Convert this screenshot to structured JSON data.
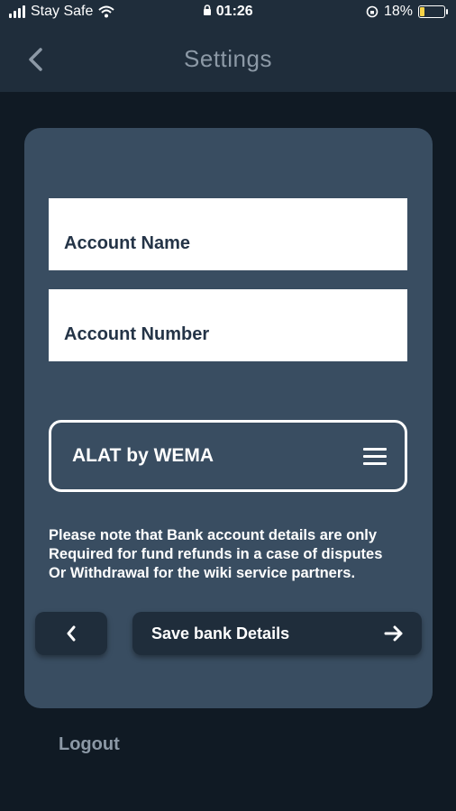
{
  "status_bar": {
    "carrier": "Stay Safe",
    "time": "01:26",
    "battery": "18%"
  },
  "nav": {
    "title": "Settings"
  },
  "form": {
    "account_name_placeholder": "Account Name",
    "account_number_placeholder": "Account Number",
    "bank_selected": "ALAT by WEMA",
    "note_lines": [
      "Please note that Bank account details are only",
      "Required for fund refunds in a case of disputes",
      "Or Withdrawal for the wiki service partners."
    ],
    "save_label": "Save bank Details"
  },
  "footer": {
    "logout_label": "Logout"
  },
  "colors": {
    "background": "#101a24",
    "bar": "#1f2d3b",
    "card": "#394d61",
    "muted_text": "#8c99a6",
    "battery": "#f6d247"
  },
  "icons": {
    "back": "chevron-left-icon",
    "menu": "hamburger-menu-icon",
    "prev": "chevron-left-icon",
    "next": "arrow-right-icon"
  }
}
